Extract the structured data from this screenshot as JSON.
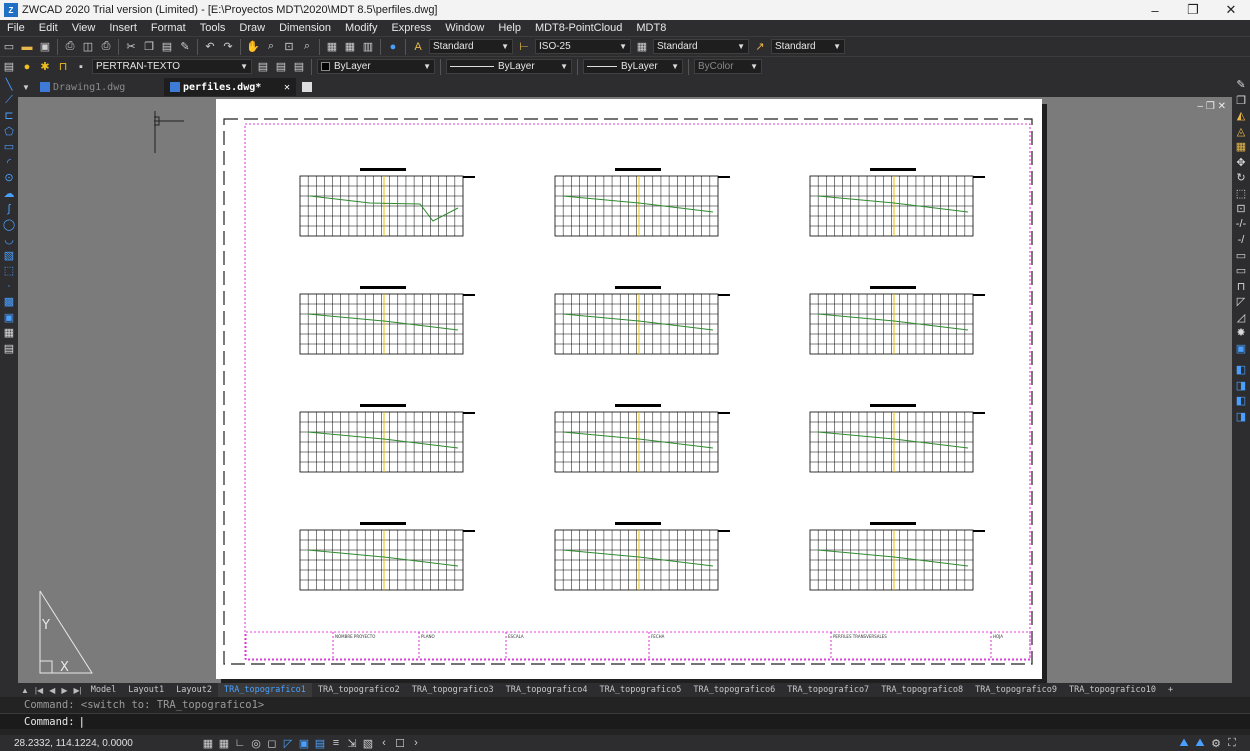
{
  "window": {
    "title": "ZWCAD 2020 Trial version (Limited) - [E:\\Proyectos MDT\\2020\\MDT 8.5\\perfiles.dwg]",
    "minimize": "–",
    "restore": "❐",
    "close": "✕"
  },
  "menu": [
    "File",
    "Edit",
    "View",
    "Insert",
    "Format",
    "Tools",
    "Draw",
    "Dimension",
    "Modify",
    "Express",
    "Window",
    "Help",
    "MDT8-PointCloud",
    "MDT8"
  ],
  "toolbar1": {
    "text_style": "Standard",
    "dim_style": "ISO-25",
    "table_style": "Standard",
    "mleader_style": "Standard"
  },
  "toolbar2": {
    "layer": "PERTRAN-TEXTO",
    "color": "ByLayer",
    "linetype": "ByLayer",
    "lineweight": "ByLayer",
    "plotstyle": "ByColor"
  },
  "doc_tabs": {
    "tab1": "Drawing1.dwg",
    "tab2": "perfiles.dwg*",
    "close": "✕"
  },
  "viewport_controls": "– ❐ ✕",
  "sheet": {
    "profiles": {
      "rows": 4,
      "cols": 3
    },
    "title_block_cells": [
      "NOMBRE PROYECTO",
      "PLANO",
      "ESCALA",
      "FECHA",
      "PERFILES TRANSVERSALES",
      "HOJA"
    ]
  },
  "layout_tabs": [
    "Model",
    "Layout1",
    "Layout2",
    "TRA_topografico1",
    "TRA_topografico2",
    "TRA_topografico3",
    "TRA_topografico4",
    "TRA_topografico5",
    "TRA_topografico6",
    "TRA_topografico7",
    "TRA_topografico8",
    "TRA_topografico9",
    "TRA_topografico10",
    "+"
  ],
  "active_layout_index": 3,
  "command": {
    "history": "Command: <switch to: TRA_topografico1>",
    "prompt": "Command:"
  },
  "status": {
    "coordinates": "28.2332, 114.1224, 0.0000"
  },
  "colors": {
    "accent": "#4aa0ff",
    "profile_line": "#2e8b2e",
    "centre_line": "#e8c000",
    "frame": "#d000d0"
  }
}
